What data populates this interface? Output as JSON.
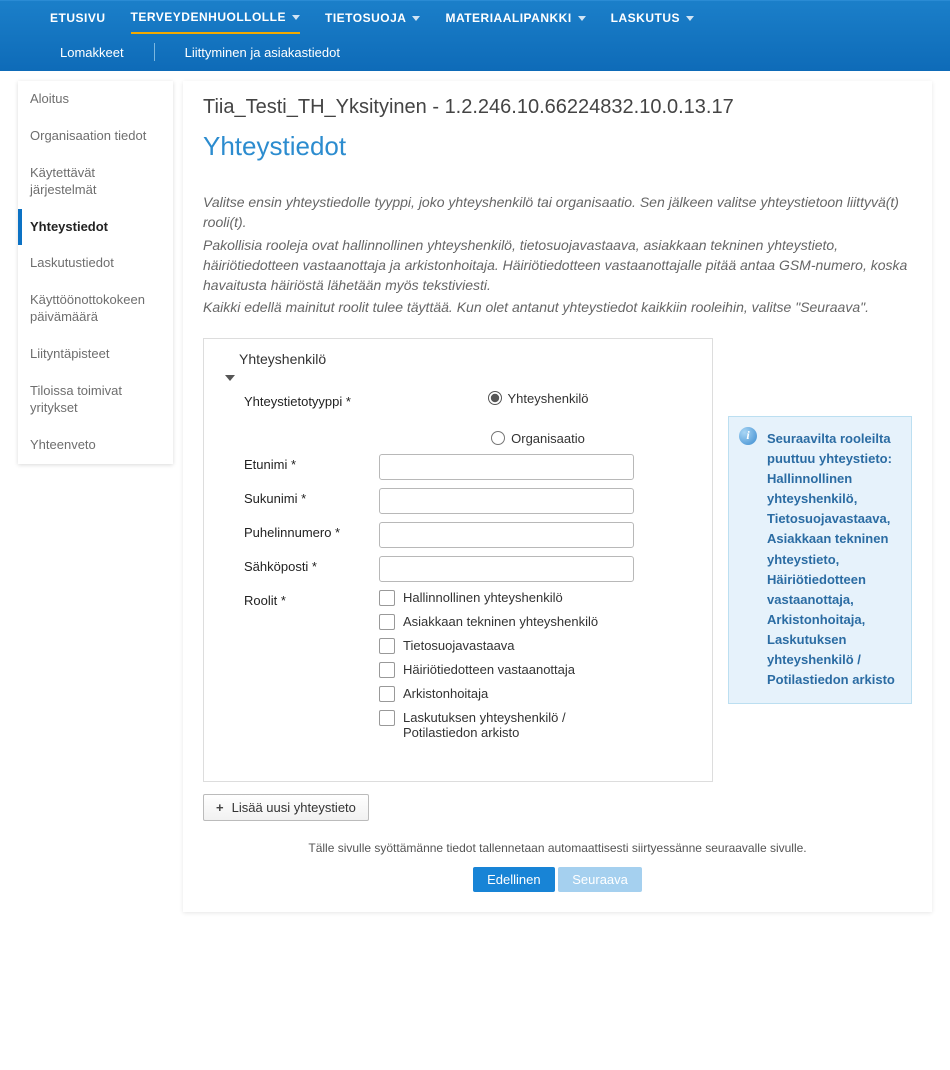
{
  "topnav": {
    "items": [
      {
        "label": "ETUSIVU",
        "dropdown": false,
        "active": false
      },
      {
        "label": "TERVEYDENHUOLLOLLE",
        "dropdown": true,
        "active": true
      },
      {
        "label": "TIETOSUOJA",
        "dropdown": true,
        "active": false
      },
      {
        "label": "MATERIAALIPANKKI",
        "dropdown": true,
        "active": false
      },
      {
        "label": "LASKUTUS",
        "dropdown": true,
        "active": false
      }
    ],
    "sub": [
      {
        "label": "Lomakkeet"
      },
      {
        "label": "Liittyminen ja asiakastiedot"
      }
    ]
  },
  "sidebar": {
    "items": [
      {
        "label": "Aloitus"
      },
      {
        "label": "Organisaation tiedot"
      },
      {
        "label": "Käytettävät järjestelmät"
      },
      {
        "label": "Yhteystiedot"
      },
      {
        "label": "Laskutustiedot"
      },
      {
        "label": "Käyttöönottokokeen päivämäärä"
      },
      {
        "label": "Liityntäpisteet"
      },
      {
        "label": "Tiloissa toimivat yritykset"
      },
      {
        "label": "Yhteenveto"
      }
    ],
    "active_index": 3
  },
  "content": {
    "breadcrumb": "Tiia_Testi_TH_Yksityinen - 1.2.246.10.66224832.10.0.13.17",
    "title": "Yhteystiedot",
    "intro": {
      "p1": "Valitse ensin yhteystiedolle tyyppi, joko yhteyshenkilö tai organisaatio. Sen jälkeen valitse yhteystietoon liittyvä(t) rooli(t).",
      "p2": "Pakollisia rooleja ovat hallinnollinen yhteyshenkilö, tietosuojavastaava, asiakkaan tekninen yhteystieto, häiriötiedotteen vastaanottaja ja arkistonhoitaja. Häiriötiedotteen vastaanottajalle pitää antaa GSM-numero, koska havaitusta häiriöstä lähetään myös tekstiviesti.",
      "p3": "Kaikki edellä mainitut roolit tulee täyttää. Kun olet antanut yhteystiedot kaikkiin rooleihin, valitse \"Seuraava\"."
    }
  },
  "card": {
    "header": "Yhteyshenkilö",
    "fields": {
      "type_label": "Yhteystietotyyppi *",
      "type_options": [
        "Yhteyshenkilö",
        "Organisaatio"
      ],
      "firstname_label": "Etunimi *",
      "lastname_label": "Sukunimi *",
      "phone_label": "Puhelinnumero *",
      "email_label": "Sähköposti *",
      "roles_label": "Roolit *",
      "roles_options": [
        "Hallinnollinen yhteyshenkilö",
        "Asiakkaan tekninen yhteyshenkilö",
        "Tietosuojavastaava",
        "Häiriötiedotteen vastaanottaja",
        "Arkistonhoitaja",
        "Laskutuksen yhteyshenkilö / Potilastiedon arkisto"
      ]
    }
  },
  "info_box": {
    "text": "Seuraavilta rooleilta puuttuu yhteystieto: Hallinnollinen yhteyshenkilö, Tietosuojavastaava, Asiakkaan tekninen yhteystieto, Häiriötiedotteen vastaanottaja, Arkistonhoitaja, Laskutuksen yhteyshenkilö / Potilastiedon arkisto"
  },
  "actions": {
    "add_contact": "Lisää uusi yhteystieto",
    "autosave_note": "Tälle sivulle syöttämänne tiedot tallennetaan automaattisesti siirtyessänne seuraavalle sivulle.",
    "prev": "Edellinen",
    "next": "Seuraava"
  }
}
